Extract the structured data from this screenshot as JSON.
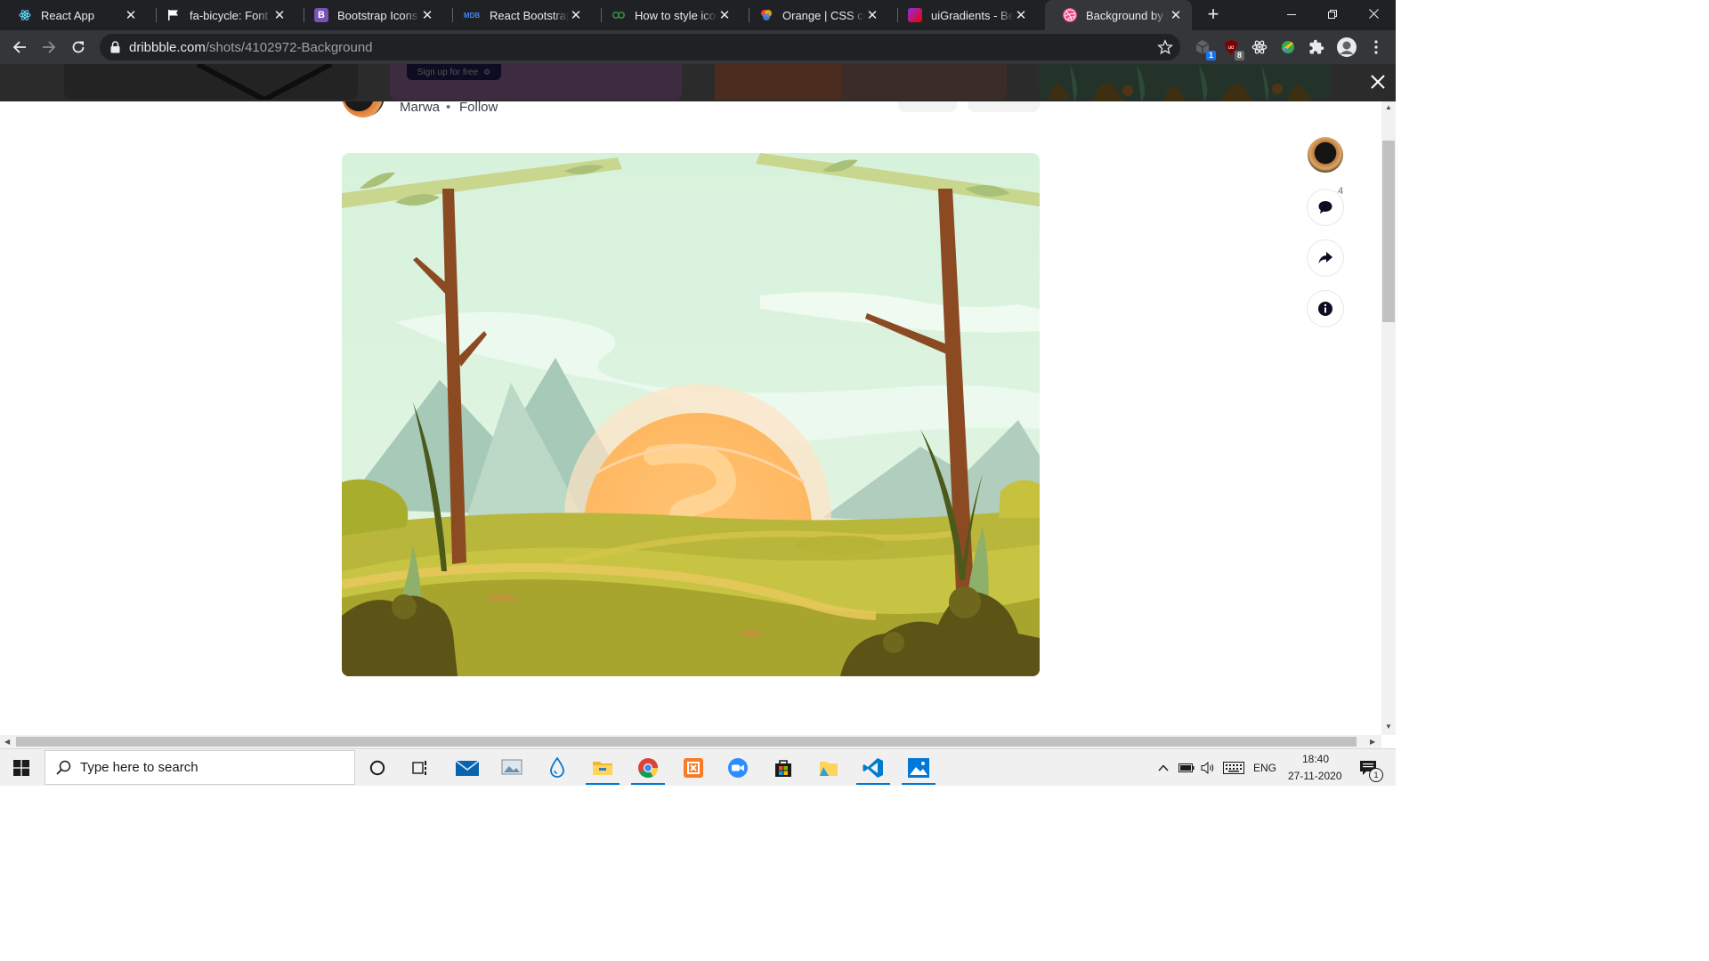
{
  "browser": {
    "tabs": [
      {
        "title": "React App",
        "icon": "react-icon",
        "active": false
      },
      {
        "title": "fa-bicycle: Font Awesome",
        "icon": "flag-icon",
        "active": false
      },
      {
        "title": "Bootstrap Icons · Official",
        "icon": "bootstrap-icon",
        "active": false
      },
      {
        "title": "React Bootstrap with Material",
        "icon": "mdb-icon",
        "active": false
      },
      {
        "title": "How to style icon color",
        "icon": "link-icon",
        "active": false
      },
      {
        "title": "Orange | CSS color",
        "icon": "color-wheel-icon",
        "active": false
      },
      {
        "title": "uiGradients - Beautiful",
        "icon": "gradient-icon",
        "active": false
      },
      {
        "title": "Background by Marwa",
        "icon": "dribbble-icon",
        "active": true
      }
    ],
    "url_host": "dribbble.com",
    "url_path": "/shots/4102972-Background",
    "extension_badges": {
      "first": "1",
      "second": "8"
    }
  },
  "behind": {
    "signup_label": "Sign up for free"
  },
  "shot": {
    "author": "Marwa",
    "separator": "•",
    "follow_label": "Follow",
    "comment_count": "4"
  },
  "taskbar": {
    "search_placeholder": "Type here to search",
    "language": "ENG",
    "time": "18:40",
    "date": "27-11-2020",
    "notification_count": "1"
  },
  "colors": {
    "accent_dribbble": "#ea4c89",
    "taskbar_accent": "#0078d7",
    "chrome_dark": "#202124"
  }
}
